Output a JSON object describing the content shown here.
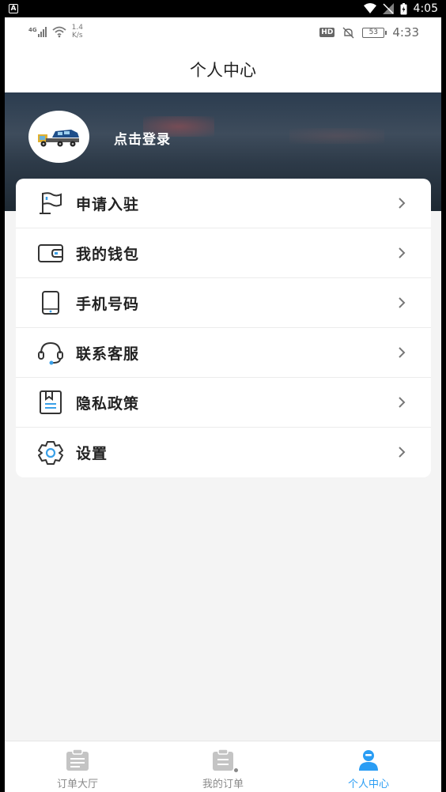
{
  "system_bar": {
    "badge": "A",
    "time": "4:05"
  },
  "inner_status": {
    "network": "4G",
    "speed_value": "1.4",
    "speed_unit": "K/s",
    "hd": "HD",
    "battery": "53",
    "time": "4:33"
  },
  "header": {
    "title": "个人中心"
  },
  "profile": {
    "login_label": "点击登录"
  },
  "menu": {
    "items": [
      {
        "label": "申请入驻",
        "icon": "flag-icon"
      },
      {
        "label": "我的钱包",
        "icon": "wallet-icon"
      },
      {
        "label": "手机号码",
        "icon": "phone-icon"
      },
      {
        "label": "联系客服",
        "icon": "headset-icon"
      },
      {
        "label": "隐私政策",
        "icon": "document-icon"
      },
      {
        "label": "设置",
        "icon": "gear-icon"
      }
    ]
  },
  "bottom_nav": {
    "tabs": [
      {
        "label": "订单大厅",
        "icon": "clipboard-list-icon",
        "active": false
      },
      {
        "label": "我的订单",
        "icon": "clipboard-icon",
        "active": false
      },
      {
        "label": "个人中心",
        "icon": "user-icon",
        "active": true
      }
    ]
  },
  "colors": {
    "accent": "#2a9df4",
    "icon_dark": "#333333",
    "icon_accent": "#3aa0e8"
  }
}
